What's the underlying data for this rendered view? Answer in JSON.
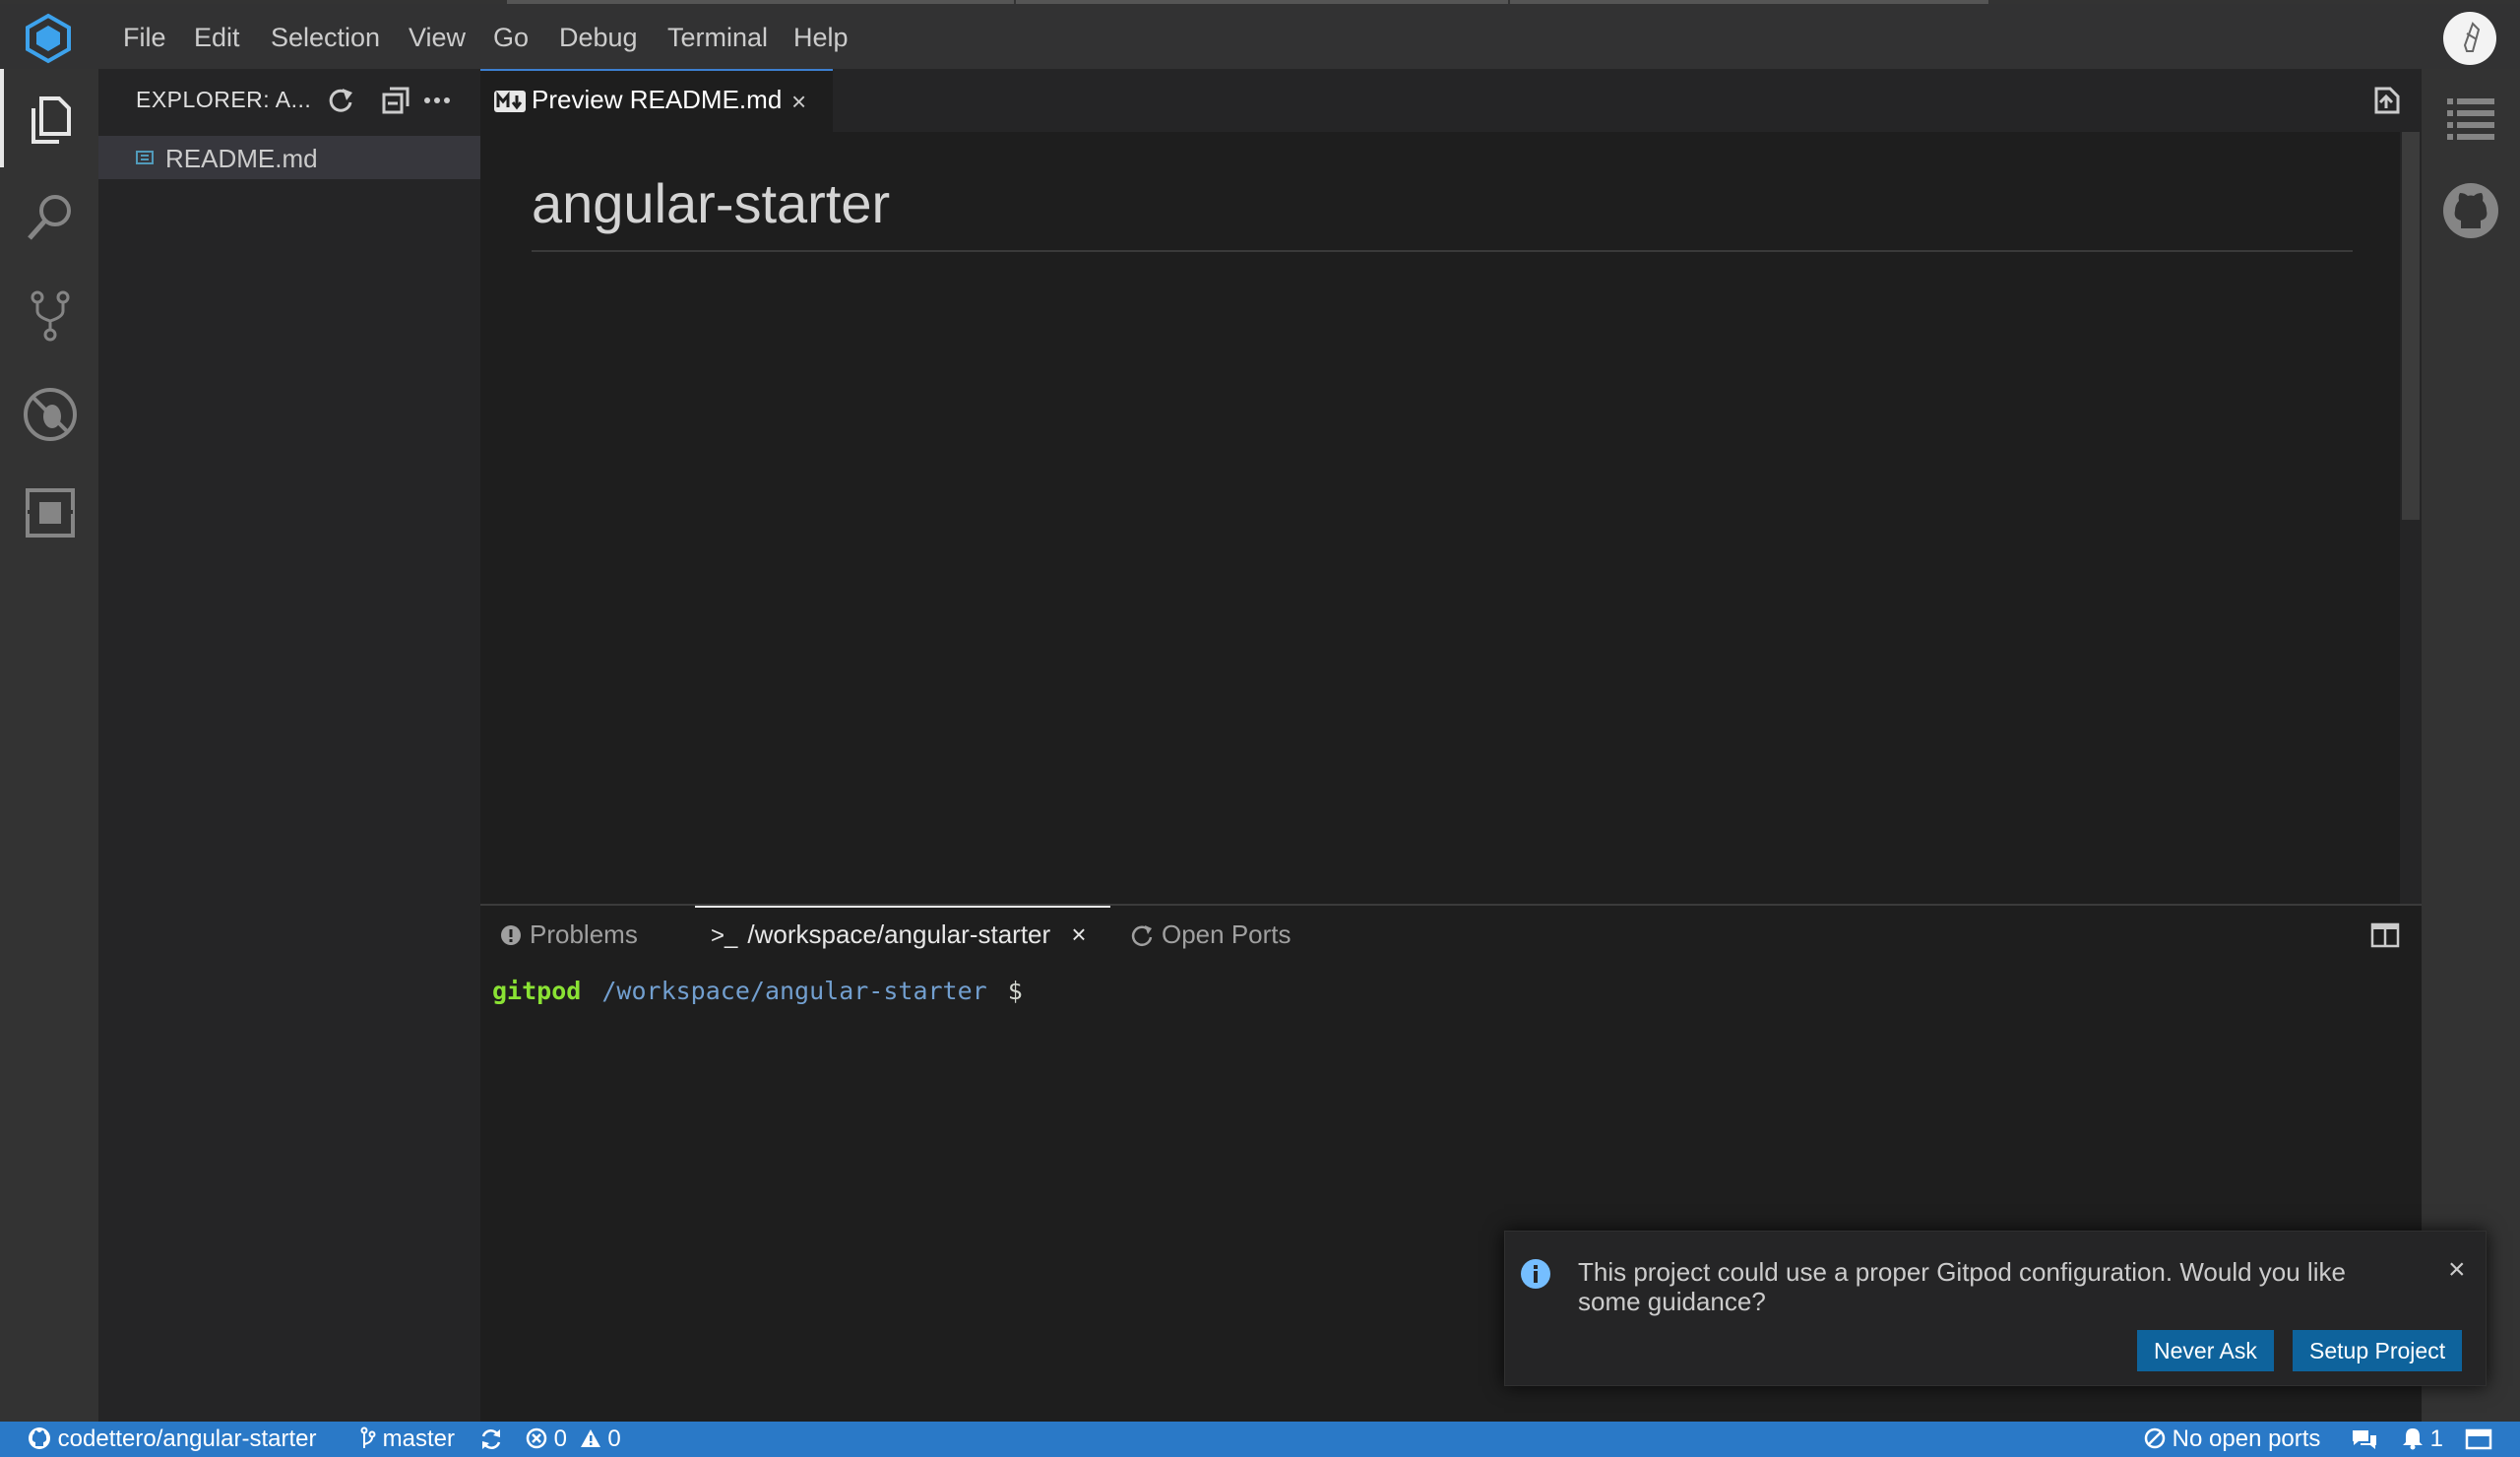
{
  "menu": [
    "File",
    "Edit",
    "Selection",
    "View",
    "Go",
    "Debug",
    "Terminal",
    "Help"
  ],
  "activity_bar": {
    "items": [
      "explorer-icon",
      "search-icon",
      "source-control-icon",
      "debug-icon",
      "extensions-icon"
    ],
    "right_items": [
      "outline-icon",
      "github-icon"
    ]
  },
  "sidebar": {
    "title": "EXPLORER: A...",
    "tools": [
      "refresh-icon",
      "collapse-all-icon",
      "more-icon"
    ],
    "files": [
      {
        "name": "README.md",
        "icon": "markdown-file-icon"
      }
    ]
  },
  "editor": {
    "tab": {
      "label": "Preview README.md",
      "close": "×"
    },
    "heading": "angular-starter"
  },
  "panel": {
    "tabs": [
      "Problems",
      "/workspace/angular-starter",
      "Open Ports"
    ],
    "terminal_prefix": ">_",
    "close": "×",
    "terminal": {
      "user": "gitpod",
      "path": "/workspace/angular-starter",
      "prompt": "$"
    }
  },
  "notification": {
    "message": "This project could use a proper Gitpod configuration. Would you like some guidance?",
    "buttons": [
      "Never Ask",
      "Setup Project"
    ],
    "close": "×"
  },
  "status_bar": {
    "repo": "codettero/angular-starter",
    "branch": "master",
    "errors": "0",
    "warnings": "0",
    "ports": "No open ports",
    "notifications": "1"
  },
  "colors": {
    "accent": "#3c7fd0",
    "status_bar": "#2a79c7",
    "button": "#0e639c",
    "terminal_user": "#8ae234",
    "terminal_path": "#729fcf"
  }
}
